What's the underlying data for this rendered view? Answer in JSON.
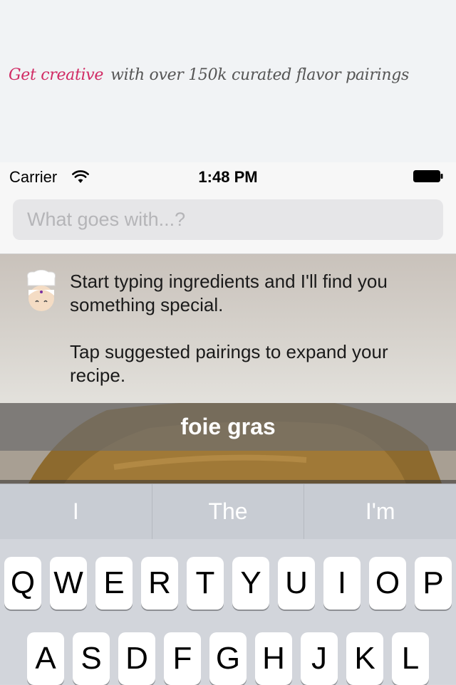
{
  "banner": {
    "accent": "Get creative",
    "rest": "with over 150k curated flavor pairings",
    "accent_color": "#d12a64"
  },
  "status": {
    "carrier": "Carrier",
    "time": "1:48 PM",
    "wifi_icon": "wifi-icon",
    "battery_icon": "battery-icon"
  },
  "search": {
    "placeholder": "What goes with...?",
    "value": ""
  },
  "tip": {
    "line1": "Start typing ingredients and I'll find you something special.",
    "line2": "Tap suggested pairings to expand your recipe.",
    "icon": "chef-icon"
  },
  "pairing": {
    "label": "foie gras"
  },
  "keyboard": {
    "predictions": [
      "I",
      "The",
      "I'm"
    ],
    "row1": [
      "Q",
      "W",
      "E",
      "R",
      "T",
      "Y",
      "U",
      "I",
      "O",
      "P"
    ],
    "row2": [
      "A",
      "S",
      "D",
      "F",
      "G",
      "H",
      "J",
      "K",
      "L"
    ]
  }
}
